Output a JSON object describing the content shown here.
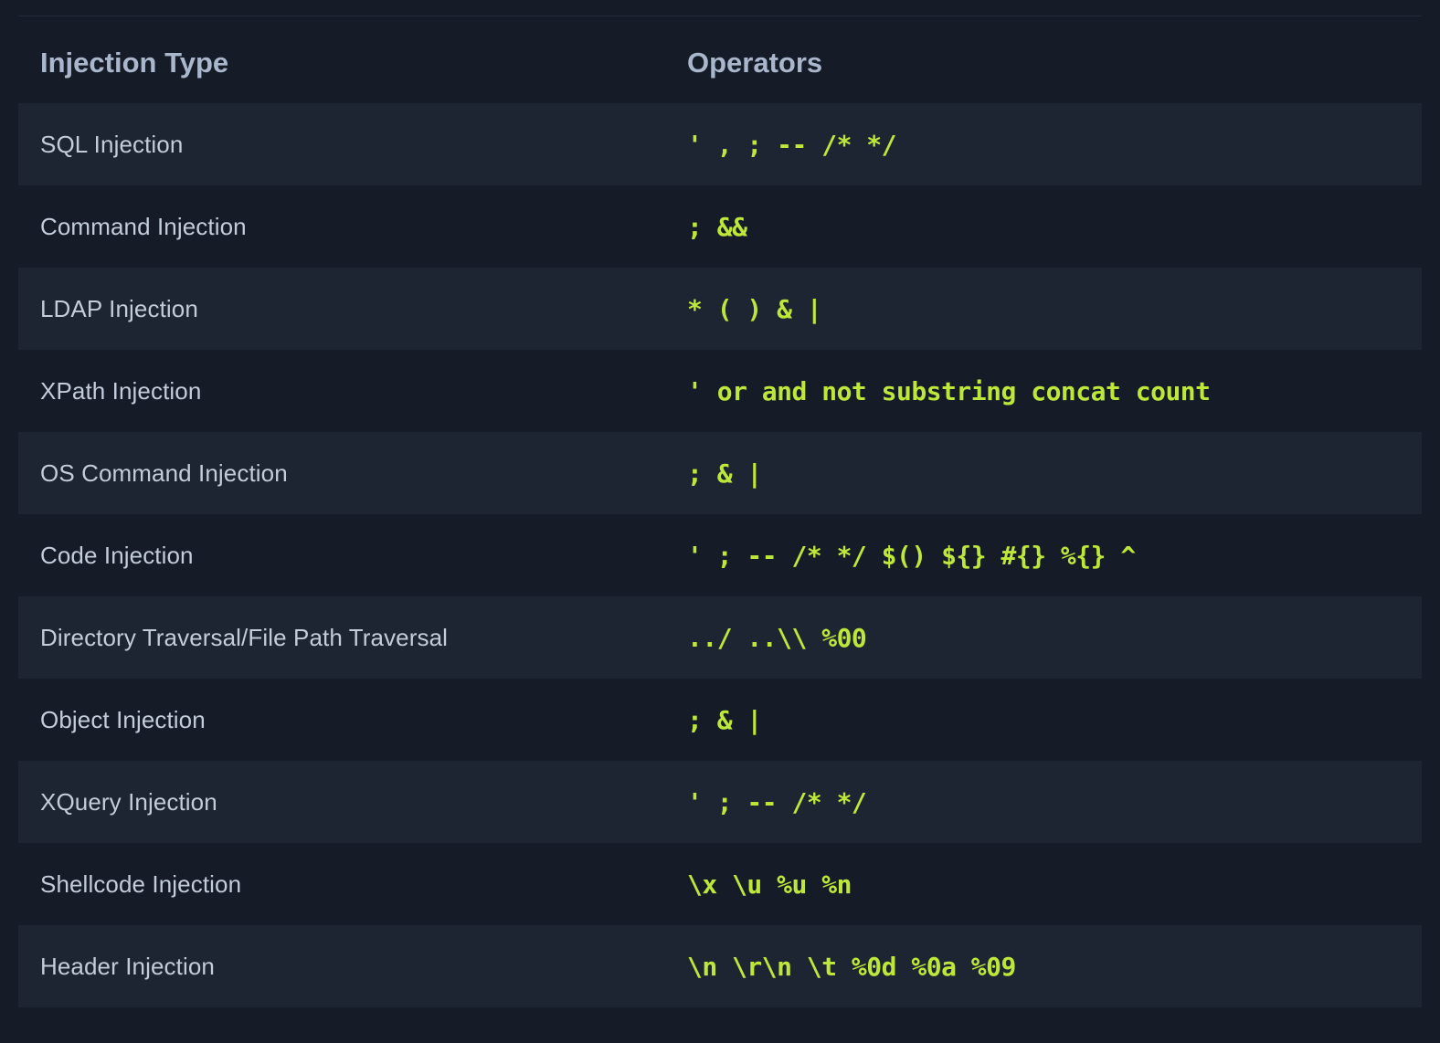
{
  "table": {
    "headers": {
      "type": "Injection Type",
      "operators": "Operators"
    },
    "rows": [
      {
        "type": "SQL Injection",
        "operators": "' , ; -- /* */"
      },
      {
        "type": "Command Injection",
        "operators": "; &&"
      },
      {
        "type": "LDAP Injection",
        "operators": "* ( ) & |"
      },
      {
        "type": "XPath Injection",
        "operators": "' or and not substring concat count"
      },
      {
        "type": "OS Command Injection",
        "operators": "; & |"
      },
      {
        "type": "Code Injection",
        "operators": "' ; -- /* */ $() ${} #{} %{} ^"
      },
      {
        "type": "Directory Traversal/File Path Traversal",
        "operators": "../ ..\\\\ %00"
      },
      {
        "type": "Object Injection",
        "operators": "; & |"
      },
      {
        "type": "XQuery Injection",
        "operators": "' ; -- /* */"
      },
      {
        "type": "Shellcode Injection",
        "operators": "\\x \\u %u %n"
      },
      {
        "type": "Header Injection",
        "operators": "\\n \\r\\n \\t %0d %0a %09"
      }
    ]
  }
}
